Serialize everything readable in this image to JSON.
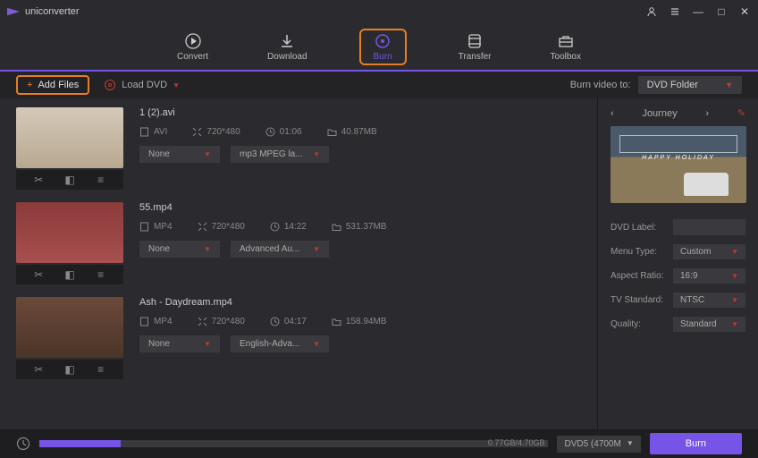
{
  "app": {
    "name": "uniconverter"
  },
  "nav": {
    "items": [
      {
        "label": "Convert"
      },
      {
        "label": "Download"
      },
      {
        "label": "Burn"
      },
      {
        "label": "Transfer"
      },
      {
        "label": "Toolbox"
      }
    ]
  },
  "toolbar": {
    "add_files": "Add Files",
    "load_dvd": "Load DVD",
    "burn_to_label": "Burn video to:",
    "burn_to_value": "DVD Folder"
  },
  "files": [
    {
      "name": "1 (2).avi",
      "format": "AVI",
      "resolution": "720*480",
      "duration": "01:06",
      "size": "40.87MB",
      "subtitle": "None",
      "audio": "mp3 MPEG la..."
    },
    {
      "name": "55.mp4",
      "format": "MP4",
      "resolution": "720*480",
      "duration": "14:22",
      "size": "531.37MB",
      "subtitle": "None",
      "audio": "Advanced Au..."
    },
    {
      "name": "Ash - Daydream.mp4",
      "format": "MP4",
      "resolution": "720*480",
      "duration": "04:17",
      "size": "158.94MB",
      "subtitle": "None",
      "audio": "English-Adva..."
    }
  ],
  "template": {
    "name": "Journey",
    "text": "HAPPY HOLIDAY"
  },
  "settings": {
    "dvd_label_key": "DVD Label:",
    "dvd_label_val": "",
    "menu_type_key": "Menu Type:",
    "menu_type_val": "Custom",
    "aspect_key": "Aspect Ratio:",
    "aspect_val": "16:9",
    "tv_key": "TV Standard:",
    "tv_val": "NTSC",
    "quality_key": "Quality:",
    "quality_val": "Standard"
  },
  "footer": {
    "progress_text": "0.77GB/4.70GB",
    "disc": "DVD5 (4700M",
    "burn_label": "Burn"
  }
}
